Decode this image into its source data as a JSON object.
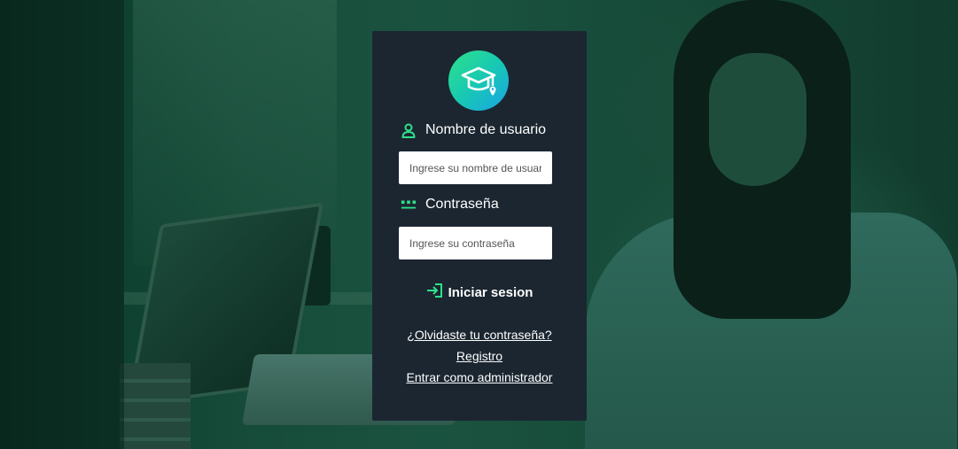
{
  "login": {
    "username_label": "Nombre de usuario",
    "username_placeholder": "Ingrese su nombre de usuario",
    "password_label": "Contraseña",
    "password_placeholder": "Ingrese su contraseña",
    "submit_label": "Iniciar sesion"
  },
  "links": {
    "forgot_password": "¿Olvidaste tu contraseña?",
    "register": "Registro",
    "admin_login": "Entrar como administrador"
  },
  "icons": {
    "logo": "graduation-cap-icon",
    "username": "user-icon",
    "password": "password-dots-icon",
    "submit": "sign-in-icon"
  },
  "colors": {
    "accent": "#2fe08a",
    "card_background": "#1b2631",
    "background_tint": "#0f3a2c"
  }
}
